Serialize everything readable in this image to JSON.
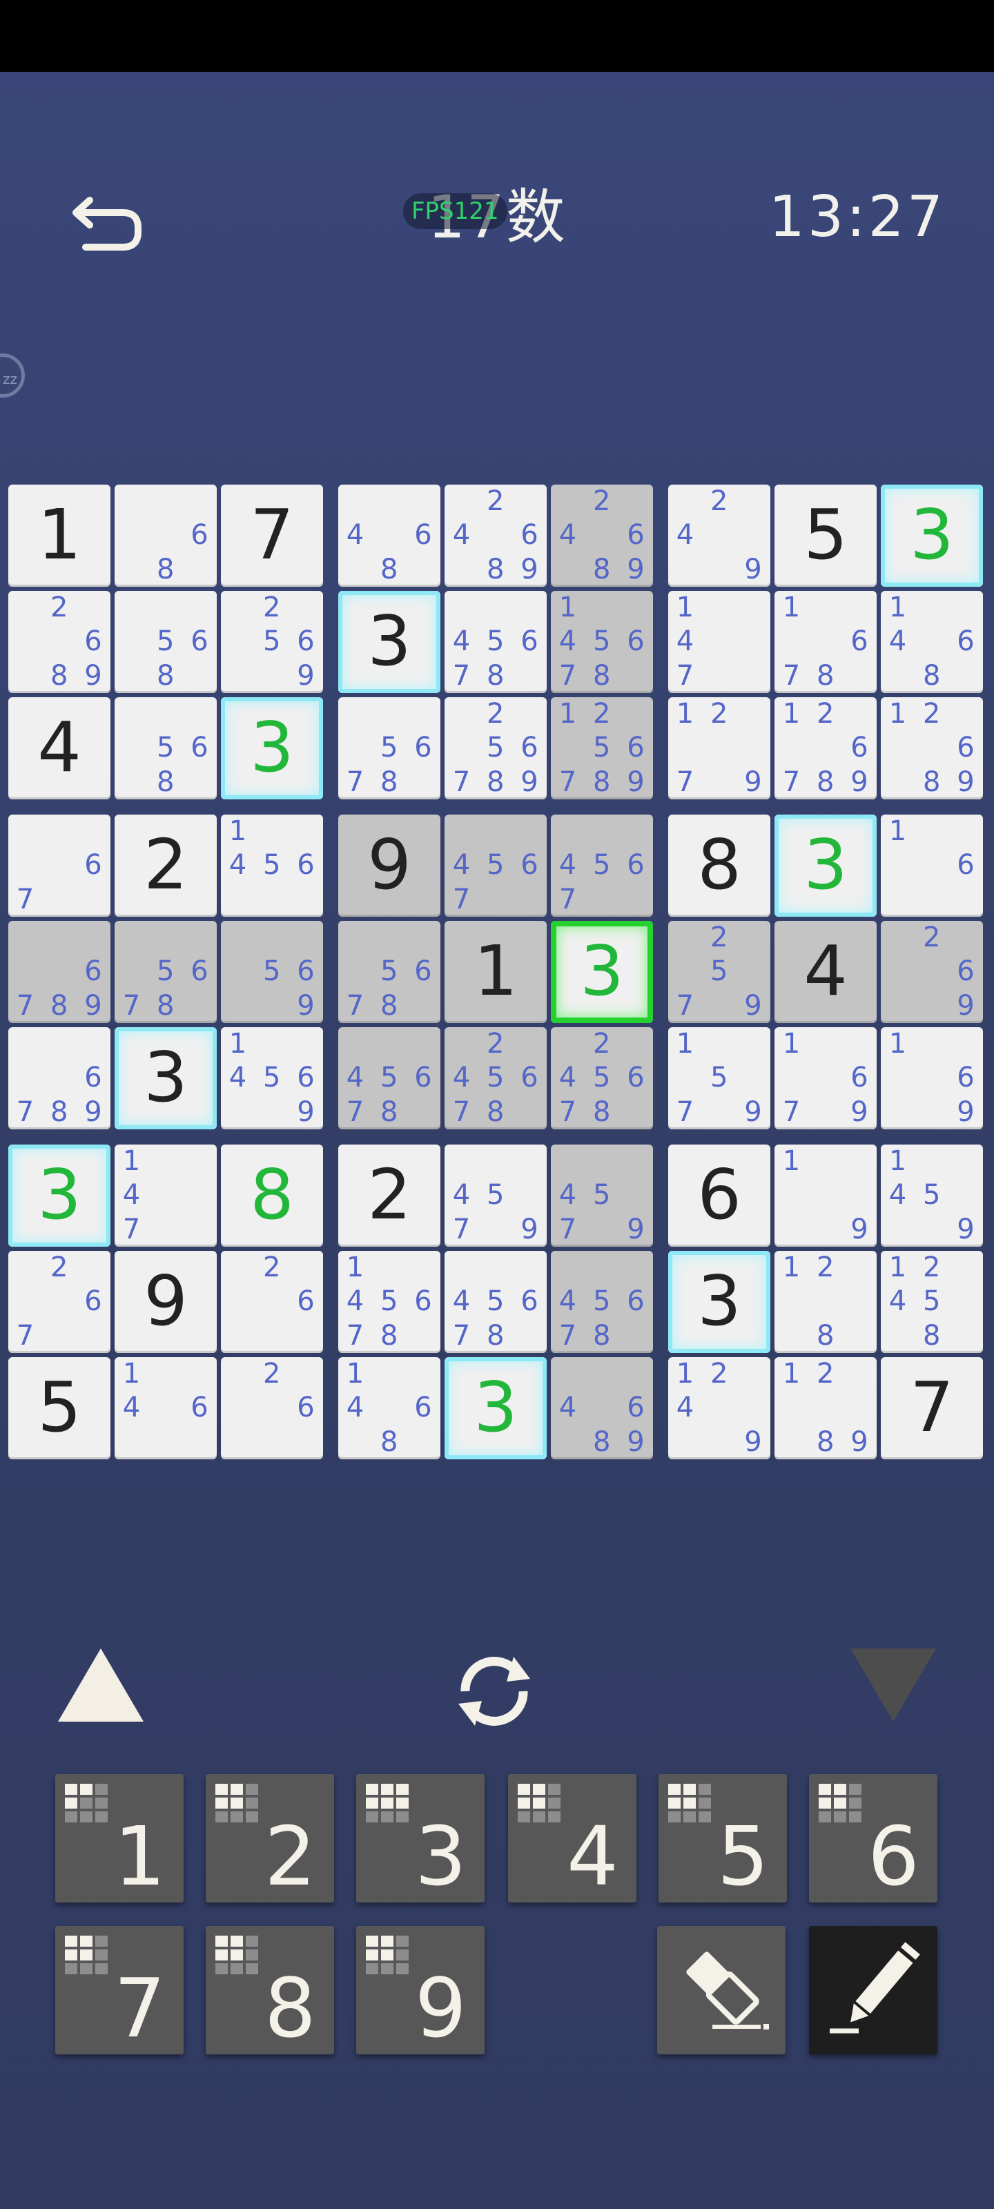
{
  "header": {
    "title": "17数",
    "fps": "FPS121",
    "timer": "13:27",
    "side_badge": "zz"
  },
  "board": {
    "rows": [
      [
        {
          "v": "1"
        },
        {
          "n": "68"
        },
        {
          "v": "7"
        },
        {
          "n": "468"
        },
        {
          "n": "24689"
        },
        {
          "n": "24689",
          "s": 1
        },
        {
          "n": "249"
        },
        {
          "v": "5"
        },
        {
          "v": "3",
          "g": 1,
          "h": "blue"
        }
      ],
      [
        {
          "n": "2689"
        },
        {
          "n": "568"
        },
        {
          "n": "2569"
        },
        {
          "v": "3",
          "h": "blue"
        },
        {
          "n": "45678"
        },
        {
          "n": "145678",
          "s": 1
        },
        {
          "n": "147"
        },
        {
          "n": "1678"
        },
        {
          "n": "1468"
        }
      ],
      [
        {
          "v": "4"
        },
        {
          "n": "568"
        },
        {
          "v": "3",
          "g": 1,
          "h": "blue"
        },
        {
          "n": "5678"
        },
        {
          "n": "256789"
        },
        {
          "n": "1256789",
          "s": 1
        },
        {
          "n": "1279"
        },
        {
          "n": "126789"
        },
        {
          "n": "12689"
        }
      ],
      [
        {
          "n": "67"
        },
        {
          "v": "2"
        },
        {
          "n": "1456"
        },
        {
          "v": "9",
          "s": 1
        },
        {
          "n": "4567",
          "s": 1
        },
        {
          "n": "4567",
          "s": 1
        },
        {
          "v": "8"
        },
        {
          "v": "3",
          "g": 1,
          "h": "blue"
        },
        {
          "n": "16"
        }
      ],
      [
        {
          "n": "6789",
          "s": 1
        },
        {
          "n": "5678",
          "s": 1
        },
        {
          "n": "569",
          "s": 1
        },
        {
          "n": "5678",
          "s": 1
        },
        {
          "v": "1",
          "s": 1
        },
        {
          "v": "3",
          "g": 1,
          "h": "green"
        },
        {
          "n": "2579",
          "s": 1
        },
        {
          "v": "4",
          "s": 1
        },
        {
          "n": "269",
          "s": 1
        }
      ],
      [
        {
          "n": "6789"
        },
        {
          "v": "3",
          "h": "blue"
        },
        {
          "n": "14569"
        },
        {
          "n": "45678",
          "s": 1
        },
        {
          "n": "245678",
          "s": 1
        },
        {
          "n": "245678",
          "s": 1
        },
        {
          "n": "1579"
        },
        {
          "n": "1679"
        },
        {
          "n": "169"
        }
      ],
      [
        {
          "v": "3",
          "g": 1,
          "h": "blue"
        },
        {
          "n": "147"
        },
        {
          "v": "8",
          "g": 1
        },
        {
          "v": "2"
        },
        {
          "n": "4579"
        },
        {
          "n": "4579",
          "s": 1
        },
        {
          "v": "6"
        },
        {
          "n": "19"
        },
        {
          "n": "1459"
        }
      ],
      [
        {
          "n": "267"
        },
        {
          "v": "9"
        },
        {
          "n": "26"
        },
        {
          "n": "145678"
        },
        {
          "n": "45678"
        },
        {
          "n": "45678",
          "s": 1
        },
        {
          "v": "3",
          "h": "blue"
        },
        {
          "n": "128"
        },
        {
          "n": "12458"
        }
      ],
      [
        {
          "v": "5"
        },
        {
          "n": "146"
        },
        {
          "n": "26"
        },
        {
          "n": "1468"
        },
        {
          "v": "3",
          "g": 1,
          "h": "blue"
        },
        {
          "n": "4689",
          "s": 1
        },
        {
          "n": "1249"
        },
        {
          "n": "1289"
        },
        {
          "v": "7"
        }
      ]
    ]
  },
  "controls": {
    "up_icon": "triangle-up-icon",
    "refresh_icon": "refresh-icon",
    "down_icon": "triangle-down-icon"
  },
  "keypad": {
    "keys": [
      {
        "label": "1",
        "mini": [
          1,
          1,
          0,
          1,
          0,
          0
        ]
      },
      {
        "label": "2",
        "mini": [
          1,
          1,
          0,
          1,
          1,
          0
        ]
      },
      {
        "label": "3",
        "mini": [
          1,
          1,
          1,
          1,
          1,
          1
        ]
      },
      {
        "label": "4",
        "mini": [
          1,
          1,
          0,
          1,
          1,
          0
        ]
      },
      {
        "label": "5",
        "mini": [
          1,
          1,
          0,
          1,
          1,
          0
        ]
      },
      {
        "label": "6",
        "mini": [
          1,
          1,
          0,
          1,
          1,
          0
        ]
      },
      {
        "label": "7",
        "mini": [
          1,
          1,
          0,
          1,
          1,
          0
        ]
      },
      {
        "label": "8",
        "mini": [
          1,
          1,
          0,
          1,
          1,
          0
        ]
      },
      {
        "label": "9",
        "mini": [
          1,
          1,
          0,
          1,
          1,
          0
        ]
      }
    ],
    "tools": [
      "eraser-icon",
      "pencil-icon"
    ]
  },
  "colors": {
    "background": "#333e65",
    "note": "#5466c8",
    "green_digit": "#22b73a",
    "highlight_blue": "#8fe9f5",
    "highlight_green": "#25d12f"
  }
}
